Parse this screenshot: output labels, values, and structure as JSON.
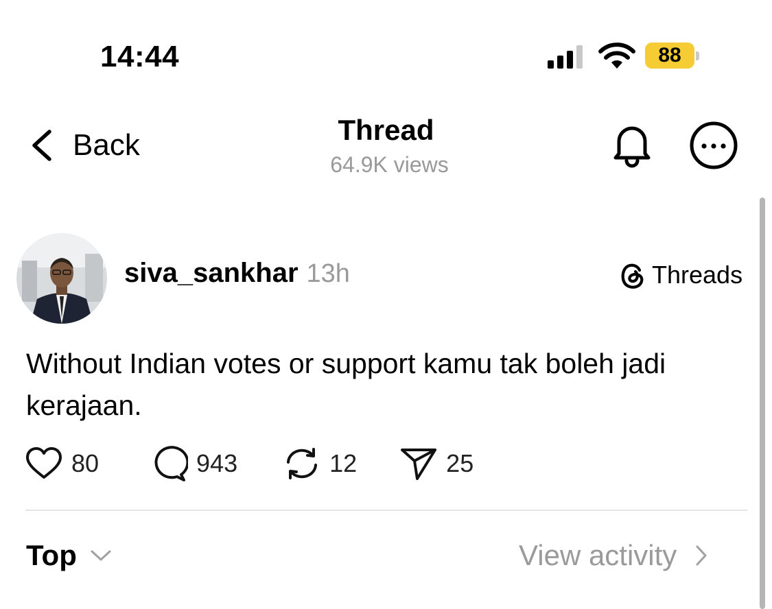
{
  "status_bar": {
    "time": "14:44",
    "battery_level": "88",
    "battery_color": "#f5cc33",
    "icons": [
      "signal-icon",
      "wifi-icon",
      "battery-icon"
    ]
  },
  "nav": {
    "back_label": "Back",
    "title": "Thread",
    "subtitle": "64.9K views",
    "icons": [
      "chevron-left-icon",
      "bell-icon",
      "more-icon"
    ]
  },
  "post": {
    "username": "siva_sankhar",
    "time_ago": "13h",
    "source_label": "Threads",
    "text": "Without Indian votes or support kamu tak boleh jadi kerajaan.",
    "actions": {
      "likes": "80",
      "comments": "943",
      "reposts": "12",
      "shares": "25"
    }
  },
  "footer": {
    "sort_label": "Top",
    "activity_label": "View activity"
  }
}
